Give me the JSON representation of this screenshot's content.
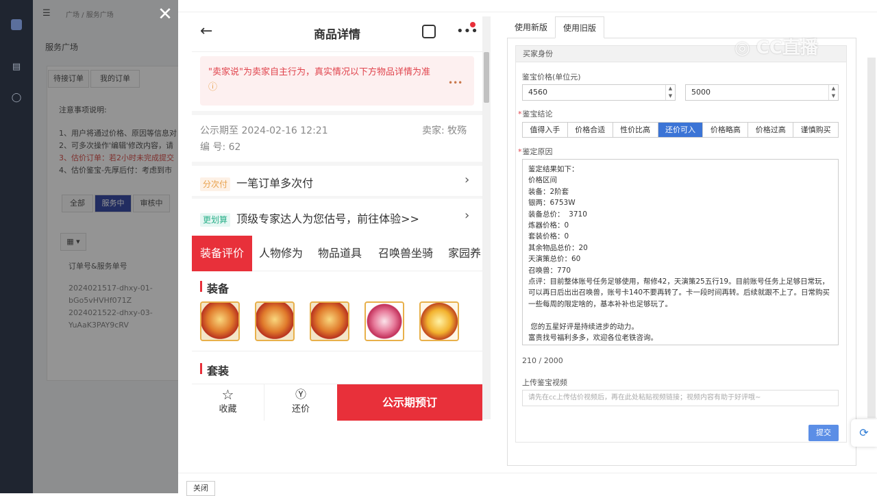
{
  "bg_app": {
    "breadcrumb": "广场 / 服务广场",
    "page_title": "服务广场",
    "tabs": [
      "待接订单",
      "我的订单"
    ],
    "notes_title": "注意事项说明:",
    "notes": [
      "1、用户将通过价格、原因等信息对",
      "2、可多次操作'编辑'修改内容，请",
      "3、估价订单：若2小时未完成提交",
      "4、估价鉴宝-先厚后付：考虑到市"
    ],
    "filter_tabs": [
      "全部",
      "服务中",
      "审核中"
    ],
    "column_header": "订单号&服务单号",
    "orders": [
      "2024021517-dhxy-01-",
      "bGo5vHVHf071Z",
      "2024021522-dhxy-03-",
      "YuAaK3PAY9cRV"
    ]
  },
  "phone": {
    "title": "商品详情",
    "notice": "\"卖家说\"为卖家自主行为，真实情况以下方物品详情为准",
    "notice_icon": "question-icon",
    "publicity": "公示期至 2024-02-16 12:21",
    "seller": "卖家: 牧殇",
    "serial": "编 号: 62",
    "pay_tag": "分次付",
    "pay_text": "一笔订单多次付",
    "appraise_tag": "更划算",
    "appraise_text": "顶级专家达人为您估号，前往体验>>",
    "categories": [
      "装备评价",
      "人物修为",
      "物品道具",
      "召唤兽坐骑",
      "家园养"
    ],
    "section_equip": "装备",
    "section_set": "套装",
    "bottom": {
      "favorite": "收藏",
      "bargain": "还价",
      "reserve": "公示期预订"
    }
  },
  "form": {
    "tabs": [
      "使用新版",
      "使用旧版"
    ],
    "fieldset_title": "买家身份",
    "price_label": "鉴宝价格(单位元)",
    "price_min": "4560",
    "price_max": "5000",
    "conclusion_label": "鉴宝结论",
    "conclusions": [
      "值得入手",
      "价格合适",
      "性价比高",
      "还价可入",
      "价格略高",
      "价格过高",
      "谨慎购买"
    ],
    "conclusion_selected": "还价可入",
    "reason_label": "鉴定原因",
    "reason_text": "鉴定结果如下：\n价格区间\n装备：2阶套\n银两：6753W\n装备总价：  3710\n炼器价格：0\n套装价格：0\n其余物品总价：20\n天演策总价：60\n召唤兽：770\n点评：目前整体账号任务足够使用，帮修42，天演策25五行19。目前账号任务上足够日常玩，可以再日后出出召唤兽，账号卡140不要再转了。卡一段时间再转。后续就跟不上了。日常购买一些每周的限定啥的，基本补补也足够玩了。\n\n 您的五星好评是持续进步的动力。\n富贵找号福利多多，欢迎各位老铁咨询。",
    "char_count": "210 / 2000",
    "video_label": "上传鉴宝视频",
    "video_placeholder": "请先在cc上传估价视频后，再在此处粘贴视频链接；视频内容有助于好评哦~",
    "submit": "提交"
  },
  "footer": {
    "close": "关闭"
  },
  "watermark": "CC直播",
  "colors": {
    "accent_red": "#e8303a",
    "primary_blue": "#3b74d6",
    "sidebar": "#1f2530"
  }
}
